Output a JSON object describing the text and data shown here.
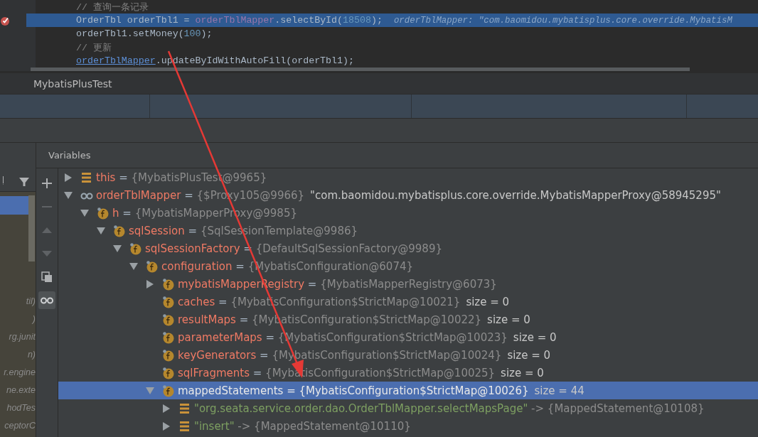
{
  "editor": {
    "lines": [
      {
        "breakpoint": false,
        "current": false,
        "tokens": [
          {
            "kind": "comment",
            "text": "// 查询一条记录"
          }
        ]
      },
      {
        "breakpoint": true,
        "current": true,
        "tokens": [
          {
            "kind": "plain",
            "text": "OrderTbl orderTbl1 = "
          },
          {
            "kind": "field",
            "text": "orderTblMapper"
          },
          {
            "kind": "plain",
            "text": ".selectById("
          },
          {
            "kind": "number",
            "text": "18508"
          },
          {
            "kind": "plain",
            "text": ");"
          },
          {
            "kind": "hint",
            "text": "orderTblMapper: \"com.baomidou.mybatisplus.core.override.MybatisM"
          }
        ]
      },
      {
        "breakpoint": false,
        "current": false,
        "tokens": [
          {
            "kind": "plain",
            "text": "orderTbl1.setMoney("
          },
          {
            "kind": "number",
            "text": "100"
          },
          {
            "kind": "plain",
            "text": ");"
          }
        ]
      },
      {
        "breakpoint": false,
        "current": false,
        "tokens": [
          {
            "kind": "comment",
            "text": "// 更新"
          }
        ]
      },
      {
        "breakpoint": false,
        "current": false,
        "tokens": [
          {
            "kind": "link",
            "text": "orderTblMapper"
          },
          {
            "kind": "plain",
            "text": ".updateByIdWithAutoFill(orderTbl1);"
          }
        ]
      }
    ]
  },
  "debug_title": "MybatisPlusTest",
  "frames": [
    {
      "text": "til)"
    },
    {
      "text": ")"
    },
    {
      "text": "rg.junit"
    },
    {
      "text": "n)"
    },
    {
      "text": "r.engine"
    },
    {
      "text": "ne.exte"
    },
    {
      "text": "hodTes"
    },
    {
      "text": "ceptorC"
    }
  ],
  "variables_title": "Variables",
  "variables": [
    {
      "kind": "object",
      "name": "this",
      "eq": "=",
      "value": "{MybatisPlusTest@9965}",
      "expanded": false,
      "selected": false
    },
    {
      "kind": "watch",
      "name": "orderTblMapper",
      "eq": "=",
      "value": "{$Proxy105@9966}",
      "detail": "\"com.baomidou.mybatisplus.core.override.MybatisMapperProxy@58945295\"",
      "expanded": true,
      "selected": false,
      "children": [
        {
          "kind": "field",
          "name": "h",
          "eq": "=",
          "value": "{MybatisMapperProxy@9985}",
          "expanded": true,
          "selected": false,
          "children": [
            {
              "kind": "field",
              "name": "sqlSession",
              "eq": "=",
              "value": "{SqlSessionTemplate@9986}",
              "expanded": true,
              "selected": false,
              "children": [
                {
                  "kind": "field",
                  "name": "sqlSessionFactory",
                  "eq": "=",
                  "value": "{DefaultSqlSessionFactory@9989}",
                  "expanded": true,
                  "selected": false,
                  "children": [
                    {
                      "kind": "field",
                      "name": "configuration",
                      "eq": "=",
                      "value": "{MybatisConfiguration@6074}",
                      "expanded": true,
                      "selected": false,
                      "children": [
                        {
                          "kind": "field",
                          "name": "mybatisMapperRegistry",
                          "eq": "=",
                          "value": "{MybatisMapperRegistry@6073}",
                          "expanded": false,
                          "selected": false
                        },
                        {
                          "kind": "field",
                          "name": "caches",
                          "eq": "=",
                          "value": "{MybatisConfiguration$StrictMap@10021}",
                          "detail": "size = 0",
                          "selected": false
                        },
                        {
                          "kind": "field",
                          "name": "resultMaps",
                          "eq": "=",
                          "value": "{MybatisConfiguration$StrictMap@10022}",
                          "detail": "size = 0",
                          "selected": false
                        },
                        {
                          "kind": "field",
                          "name": "parameterMaps",
                          "eq": "=",
                          "value": "{MybatisConfiguration$StrictMap@10023}",
                          "detail": "size = 0",
                          "selected": false
                        },
                        {
                          "kind": "field",
                          "name": "keyGenerators",
                          "eq": "=",
                          "value": "{MybatisConfiguration$StrictMap@10024}",
                          "detail": "size = 0",
                          "selected": false
                        },
                        {
                          "kind": "field",
                          "name": "sqlFragments",
                          "eq": "=",
                          "value": "{MybatisConfiguration$StrictMap@10025}",
                          "detail": "size = 0",
                          "selected": false
                        },
                        {
                          "kind": "field",
                          "name": "mappedStatements",
                          "eq": "=",
                          "value": "{MybatisConfiguration$StrictMap@10026}",
                          "detail": "size = 44",
                          "expanded": true,
                          "selected": true,
                          "children": [
                            {
                              "kind": "entry",
                              "name": "\"org.seata.service.order.dao.OrderTblMapper.selectMapsPage\"",
                              "value": "-> {MappedStatement@10108}",
                              "expanded": false,
                              "selected": false
                            },
                            {
                              "kind": "entry",
                              "name": "\"insert\"",
                              "value": "-> {MappedStatement@10110}",
                              "expanded": false,
                              "selected": false
                            }
                          ]
                        }
                      ]
                    }
                  ]
                }
              ]
            }
          ]
        }
      ]
    }
  ]
}
